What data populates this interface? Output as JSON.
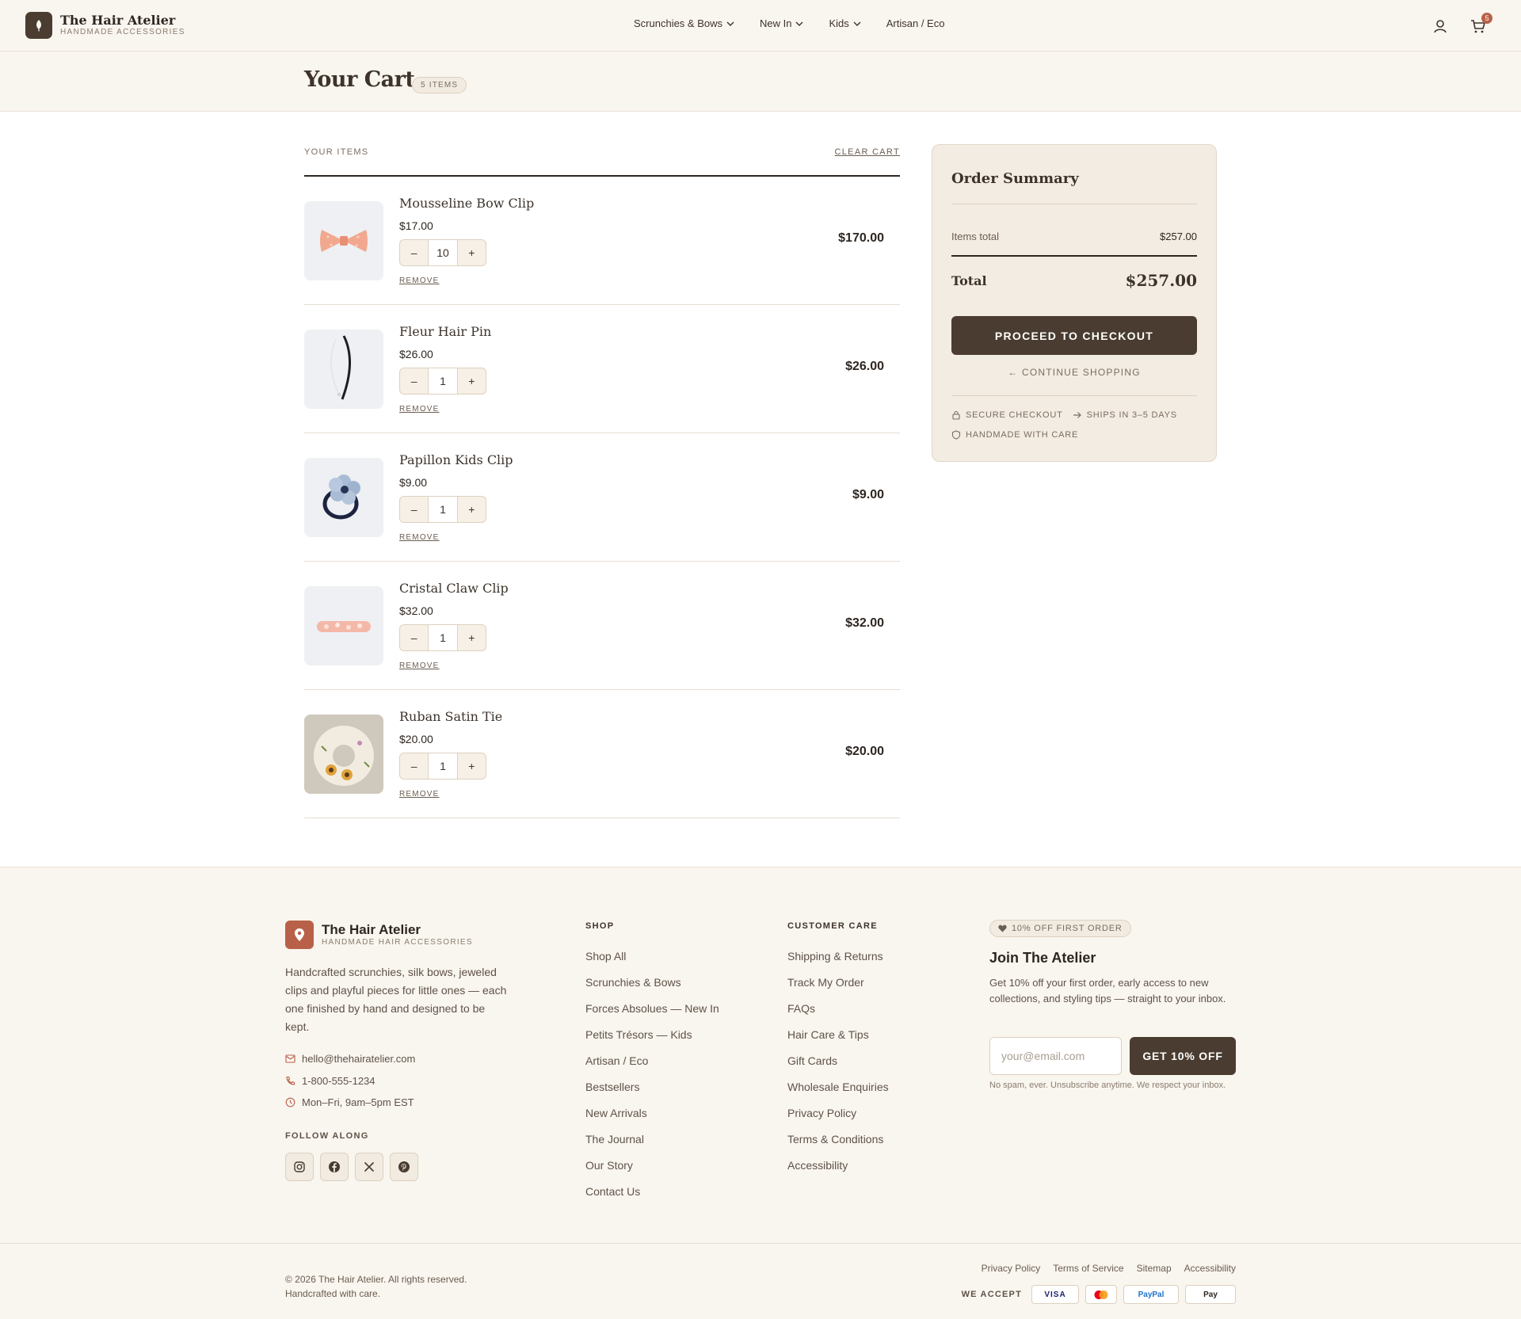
{
  "header": {
    "brand_name": "The Hair Atelier",
    "brand_sub": "HANDMADE ACCESSORIES",
    "nav": [
      "Scrunchies & Bows",
      "New In",
      "Kids",
      "Artisan / Eco"
    ],
    "cart_count": "5"
  },
  "page": {
    "title": "Your Cart",
    "items_badge": "5 ITEMS",
    "list_heading": "YOUR ITEMS",
    "clear_cart": "CLEAR CART",
    "remove_label": "REMOVE"
  },
  "cart": {
    "items": [
      {
        "name": "Mousseline Bow Clip",
        "price": "$17.00",
        "qty": "10",
        "total": "$170.00",
        "thumb_icon": "bow-clip-thumbnail"
      },
      {
        "name": "Fleur Hair Pin",
        "price": "$26.00",
        "qty": "1",
        "total": "$26.00",
        "thumb_icon": "hair-pin-thumbnail"
      },
      {
        "name": "Papillon Kids Clip",
        "price": "$9.00",
        "qty": "1",
        "total": "$9.00",
        "thumb_icon": "flower-hair-tie-thumbnail"
      },
      {
        "name": "Cristal Claw Clip",
        "price": "$32.00",
        "qty": "1",
        "total": "$32.00",
        "thumb_icon": "claw-clip-thumbnail"
      },
      {
        "name": "Ruban Satin Tie",
        "price": "$20.00",
        "qty": "1",
        "total": "$20.00",
        "thumb_icon": "scrunchie-thumbnail"
      }
    ]
  },
  "summary": {
    "title": "Order Summary",
    "items_total_label": "Items total",
    "items_total_value": "$257.00",
    "total_label": "Total",
    "total_value": "$257.00",
    "checkout_label": "PROCEED TO CHECKOUT",
    "continue_label": "← CONTINUE SHOPPING",
    "trust": [
      "SECURE CHECKOUT",
      "SHIPS IN 3–5 DAYS",
      "HANDMADE WITH CARE"
    ]
  },
  "footer": {
    "brand_name": "The Hair Atelier",
    "brand_sub": "HANDMADE HAIR ACCESSORIES",
    "description": "Handcrafted scrunchies, silk bows, jeweled clips and playful pieces for little ones — each one finished by hand and designed to be kept.",
    "email": "hello@thehairatelier.com",
    "phone": "1-800-555-1234",
    "hours": "Mon–Fri, 9am–5pm EST",
    "follow_label": "FOLLOW ALONG",
    "shop_heading": "SHOP",
    "shop_links": [
      "Shop All",
      "Scrunchies & Bows",
      "Forces Absolues — New In",
      "Petits Trésors — Kids",
      "Artisan / Eco",
      "Bestsellers",
      "New Arrivals",
      "The Journal",
      "Our Story",
      "Contact Us"
    ],
    "care_heading": "CUSTOMER CARE",
    "care_links": [
      "Shipping & Returns",
      "Track My Order",
      "FAQs",
      "Hair Care & Tips",
      "Gift Cards",
      "Wholesale Enquiries",
      "Privacy Policy",
      "Terms & Conditions",
      "Accessibility"
    ],
    "promo_badge": "10% OFF FIRST ORDER",
    "join_title": "Join The Atelier",
    "join_desc": "Get 10% off your first order, early access to new collections, and styling tips — straight to your inbox.",
    "email_placeholder": "your@email.com",
    "join_button": "GET 10% OFF",
    "fine_print": "No spam, ever. Unsubscribe anytime. We respect your inbox.",
    "copyright": "© 2026 The Hair Atelier. All rights reserved.",
    "crafted": "Handcrafted with care.",
    "legal_links": [
      "Privacy Policy",
      "Terms of Service",
      "Sitemap",
      "Accessibility"
    ],
    "we_accept": "WE ACCEPT",
    "payments": [
      "VISA",
      "Mastercard",
      "PayPal",
      "Pay"
    ]
  },
  "colors": {
    "accent_dark": "#4a3c30",
    "accent_terracotta": "#b86148",
    "cream": "#f9f5ef"
  }
}
